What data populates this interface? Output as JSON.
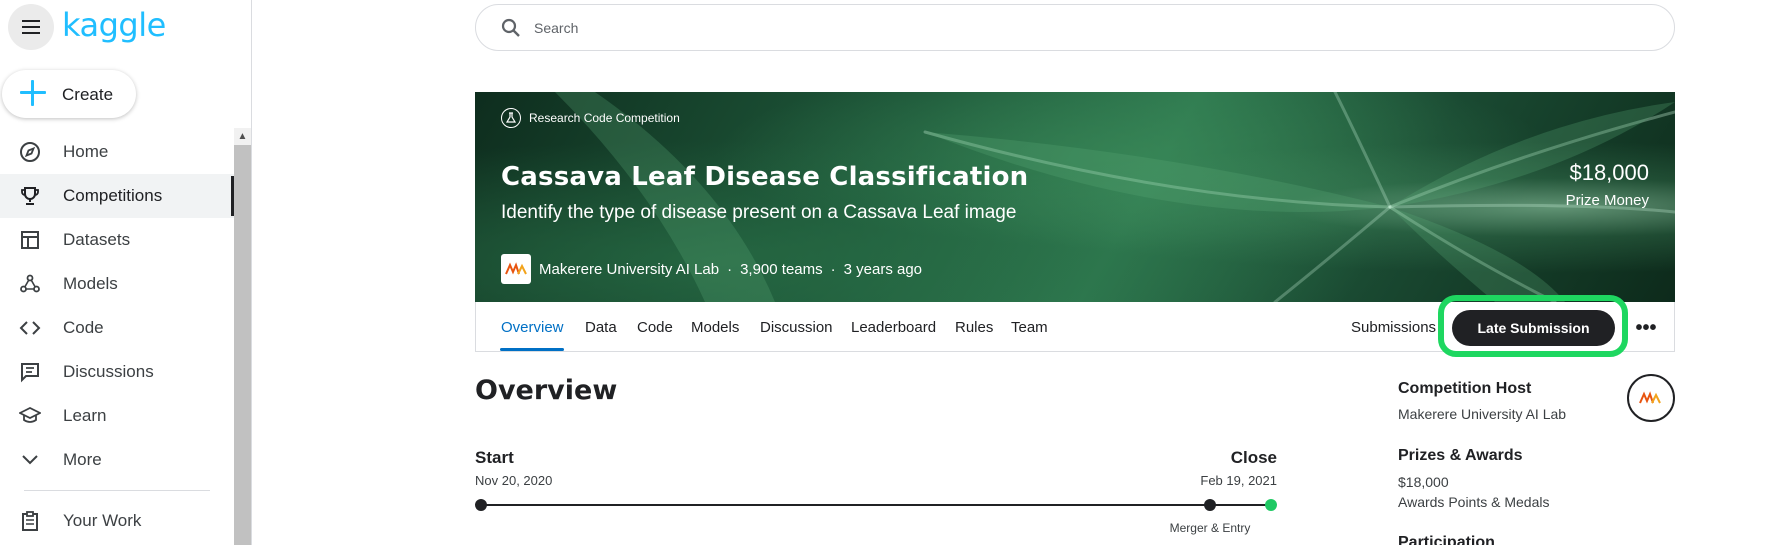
{
  "sidebar": {
    "logo": "kaggle",
    "create_label": "Create",
    "items": [
      {
        "label": "Home",
        "icon": "compass-icon"
      },
      {
        "label": "Competitions",
        "icon": "trophy-icon",
        "active": true
      },
      {
        "label": "Datasets",
        "icon": "table-icon"
      },
      {
        "label": "Models",
        "icon": "models-icon"
      },
      {
        "label": "Code",
        "icon": "code-icon"
      },
      {
        "label": "Discussions",
        "icon": "comments-icon"
      },
      {
        "label": "Learn",
        "icon": "school-icon"
      },
      {
        "label": "More",
        "icon": "chevron-down-icon"
      }
    ],
    "your_work": "Your Work"
  },
  "search": {
    "placeholder": "Search"
  },
  "banner": {
    "badge": "Research Code Competition",
    "title": "Cassava Leaf Disease Classification",
    "subtitle": "Identify the type of disease present on a Cassava Leaf image",
    "host": "Makerere University AI Lab",
    "teams": "3,900 teams",
    "age": "3 years ago",
    "prize_amount": "$18,000",
    "prize_label": "Prize Money",
    "host_logo_text": "Makerere AI Lab"
  },
  "tabs": {
    "items": [
      "Overview",
      "Data",
      "Code",
      "Models",
      "Discussion",
      "Leaderboard",
      "Rules",
      "Team"
    ],
    "active": "Overview",
    "submissions": "Submissions",
    "late_submission": "Late Submission",
    "more": "•••"
  },
  "overview": {
    "title": "Overview",
    "start_label": "Start",
    "start_date": "Nov 20, 2020",
    "close_label": "Close",
    "close_date": "Feb 19, 2021",
    "merger_label": "Merger & Entry"
  },
  "right": {
    "host_heading": "Competition Host",
    "host_name": "Makerere University AI Lab",
    "prizes_heading": "Prizes & Awards",
    "prizes_amount": "$18,000",
    "prizes_detail": "Awards Points & Medals",
    "participation_heading": "Participation"
  },
  "colors": {
    "brand": "#20beff",
    "active_tab": "#0070c5",
    "highlight": "#1ed760",
    "button_dark": "#202124"
  }
}
